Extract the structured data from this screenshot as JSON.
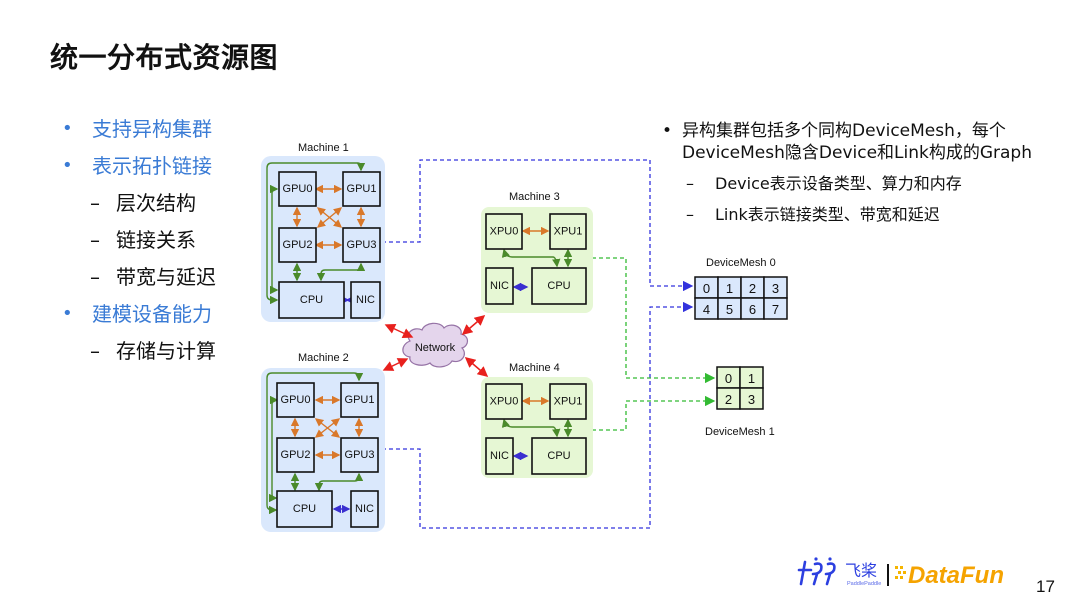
{
  "title": "统一分布式资源图",
  "left_bullets": [
    {
      "level": 1,
      "text": "支持异构集群"
    },
    {
      "level": 1,
      "text": "表示拓扑链接"
    },
    {
      "level": 2,
      "text": "层次结构"
    },
    {
      "level": 2,
      "text": "链接关系"
    },
    {
      "level": 2,
      "text": "带宽与延迟"
    },
    {
      "level": 1,
      "text": "建模设备能力"
    },
    {
      "level": 2,
      "text": "存储与计算"
    }
  ],
  "right_text": {
    "bullet": "异构集群包括多个同构DeviceMesh，每个DeviceMesh隐含Device和Link构成的Graph",
    "sub": [
      "Device表示设备类型、算力和内存",
      "Link表示链接类型、带宽和延迟"
    ]
  },
  "diagram": {
    "machines": [
      {
        "label": "Machine 1",
        "type": "gpu",
        "nodes": [
          "GPU0",
          "GPU1",
          "GPU2",
          "GPU3",
          "CPU",
          "NIC"
        ]
      },
      {
        "label": "Machine 2",
        "type": "gpu",
        "nodes": [
          "GPU0",
          "GPU1",
          "GPU2",
          "GPU3",
          "CPU",
          "NIC"
        ]
      },
      {
        "label": "Machine 3",
        "type": "xpu",
        "nodes": [
          "XPU0",
          "XPU1",
          "NIC",
          "CPU"
        ]
      },
      {
        "label": "Machine 4",
        "type": "xpu",
        "nodes": [
          "XPU0",
          "XPU1",
          "NIC",
          "CPU"
        ]
      }
    ],
    "network_label": "Network",
    "device_meshes": [
      {
        "label": "DeviceMesh 0",
        "cells": [
          [
            "0",
            "1",
            "2",
            "3"
          ],
          [
            "4",
            "5",
            "6",
            "7"
          ]
        ]
      },
      {
        "label": "DeviceMesh 1",
        "cells": [
          [
            "0",
            "1"
          ],
          [
            "2",
            "3"
          ]
        ]
      }
    ],
    "colors": {
      "gpu_machine_bg": "#dae8fc",
      "xpu_machine_bg": "#e6f7d4",
      "intra_gpu_link": "#d9782a",
      "cpu_link": "#4a8a2a",
      "nic_link": "#3a2fd0",
      "network_link": "#e8201d",
      "mesh0_link": "#3333dd",
      "mesh1_link": "#33bb33",
      "cloud_fill": "#e4d5ec",
      "cloud_stroke": "#9673a6"
    }
  },
  "footer": {
    "logo_paddle_cn": "飞桨",
    "logo_paddle_en": "PaddlePaddle",
    "logo_datafun": "DataFun",
    "page_number": "17"
  }
}
